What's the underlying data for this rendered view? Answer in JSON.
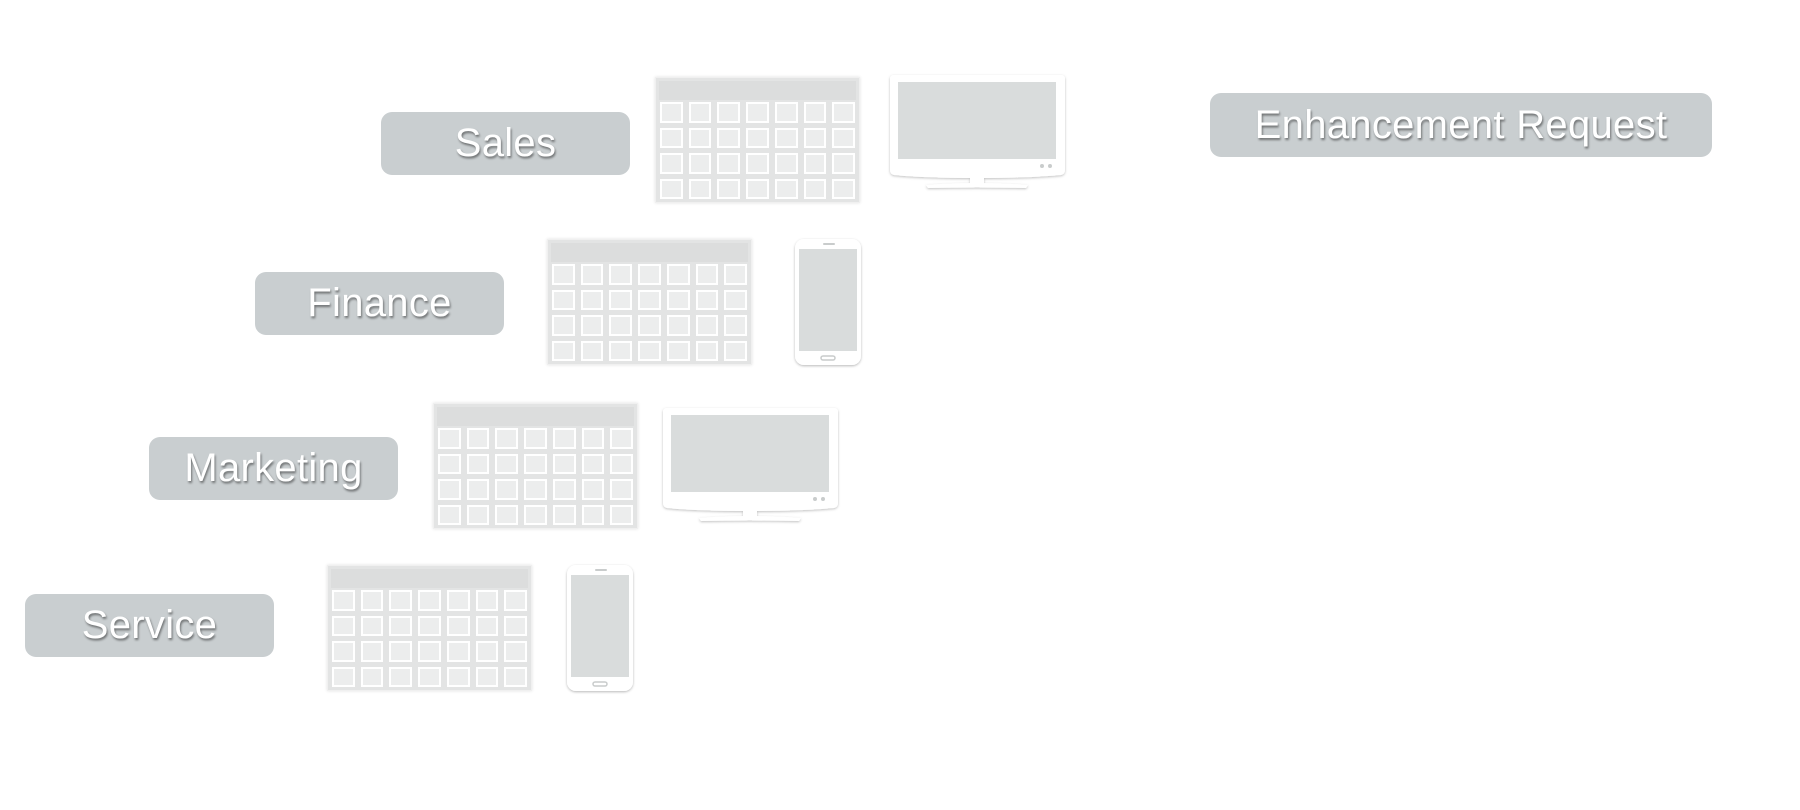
{
  "departments": [
    {
      "id": "sales",
      "label": "Sales",
      "device": "monitor-icon"
    },
    {
      "id": "finance",
      "label": "Finance",
      "device": "phone-icon"
    },
    {
      "id": "marketing",
      "label": "Marketing",
      "device": "monitor-icon"
    },
    {
      "id": "service",
      "label": "Service",
      "device": "phone-icon"
    }
  ],
  "enhancement": {
    "label": "Enhancement Request"
  },
  "colors": {
    "pill": "#c9ced0",
    "pill_text": "#ffffff",
    "screen": "#d9dcdc",
    "grid": "#e3e4e4"
  },
  "grid_icon": {
    "rows": 4,
    "columns": 7
  }
}
